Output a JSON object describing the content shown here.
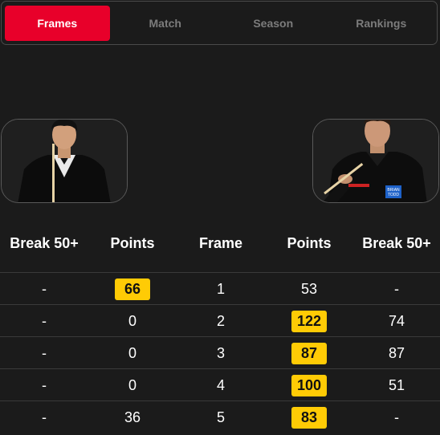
{
  "tabs": [
    {
      "label": "Frames",
      "active": true
    },
    {
      "label": "Match",
      "active": false
    },
    {
      "label": "Season",
      "active": false
    },
    {
      "label": "Rankings",
      "active": false
    }
  ],
  "players": {
    "left": {
      "photo_icon": "player-photo-icon"
    },
    "right": {
      "photo_icon": "player-photo-icon",
      "shirt_text": "BRIAN TODD"
    }
  },
  "table": {
    "headers": [
      "Break 50+",
      "Points",
      "Frame",
      "Points",
      "Break 50+"
    ],
    "rows": [
      {
        "left_break": "-",
        "left_points": "66",
        "frame": "1",
        "right_points": "53",
        "right_break": "-",
        "winner": "left"
      },
      {
        "left_break": "-",
        "left_points": "0",
        "frame": "2",
        "right_points": "122",
        "right_break": "74",
        "winner": "right"
      },
      {
        "left_break": "-",
        "left_points": "0",
        "frame": "3",
        "right_points": "87",
        "right_break": "87",
        "winner": "right"
      },
      {
        "left_break": "-",
        "left_points": "0",
        "frame": "4",
        "right_points": "100",
        "right_break": "51",
        "winner": "right"
      },
      {
        "left_break": "-",
        "left_points": "36",
        "frame": "5",
        "right_points": "83",
        "right_break": "-",
        "winner": "right"
      }
    ]
  },
  "colors": {
    "accent": "#e8002a",
    "highlight": "#ffcb05",
    "background": "#1b1b1b"
  }
}
